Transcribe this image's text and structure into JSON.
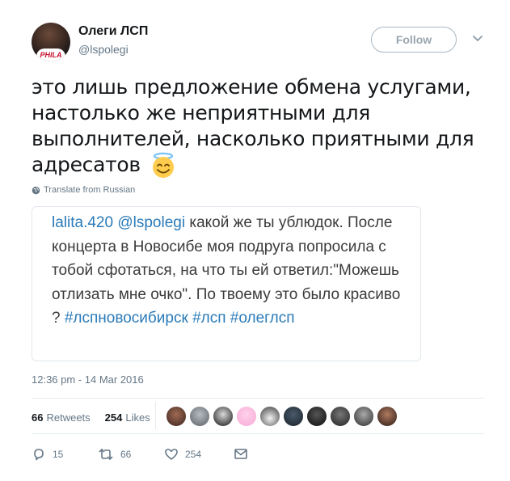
{
  "user": {
    "display_name": "Олеги ЛСП",
    "handle": "@lspolegi",
    "avatar_jersey": "PHILA"
  },
  "follow_label": "Follow",
  "tweet": {
    "text": "это лишь предложение обмена услугами, настолько же неприятными для выполнителей, насколько приятными для адресатов",
    "emoji": "smiling-face-with-halo-icon",
    "translate_label": "Translate from Russian"
  },
  "quoted": {
    "user": "lalita.420",
    "mention": "@lspolegi",
    "text": "какой же ты ублюдок. После концерта в Новосибе моя подруга попросила с тобой сфотаться, на что ты ей ответил:\"Можешь отлизать мне очко\". По твоему это было красиво ?",
    "hashtags": "#лспновосибирск #лсп #олеглсп"
  },
  "timestamp": "12:36 pm - 14 Mar 2016",
  "stats": {
    "retweets_count": "66",
    "retweets_label": "Retweets",
    "likes_count": "254",
    "likes_label": "Likes"
  },
  "actions": {
    "replies": "15",
    "retweets": "66",
    "likes": "254"
  },
  "colors": {
    "link": "#2b7bb9",
    "muted": "#657786",
    "divider": "#e6ecf0"
  }
}
